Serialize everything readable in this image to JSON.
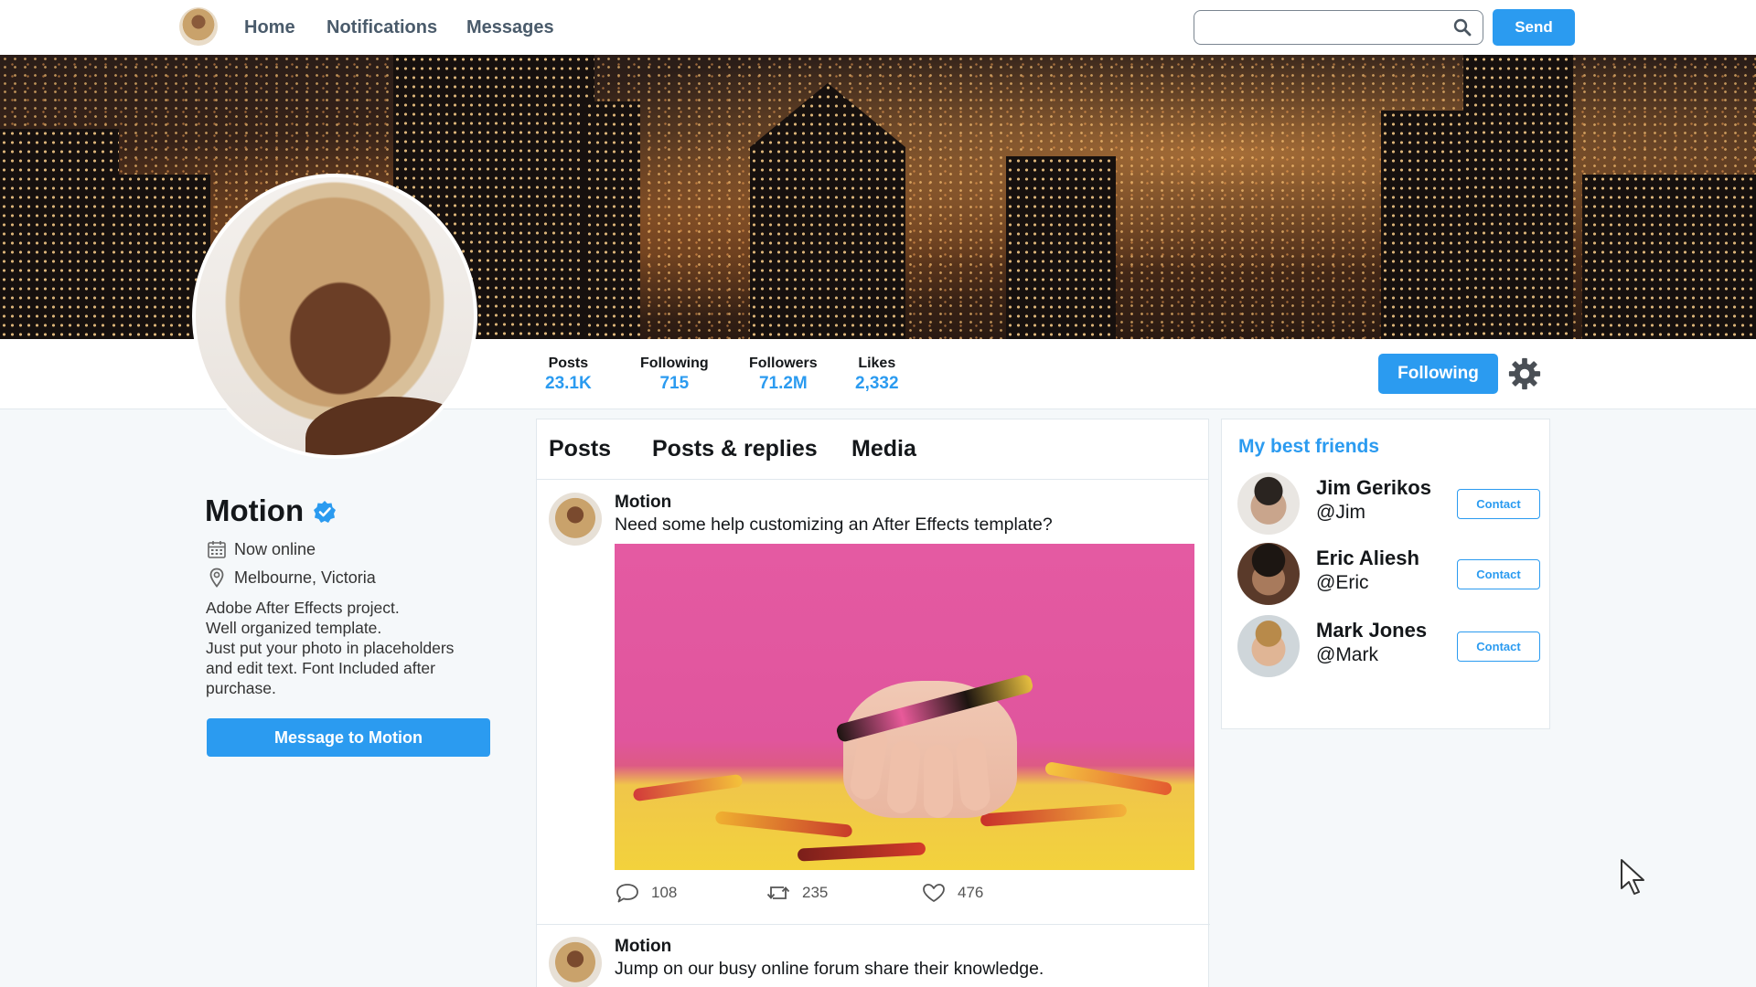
{
  "nav": {
    "links": [
      "Home",
      "Notifications",
      "Messages"
    ],
    "search": {
      "value": "",
      "placeholder": ""
    },
    "send_label": "Send"
  },
  "profile": {
    "name": "Motion",
    "status": "Now online",
    "location": "Melbourne, Victoria",
    "bio": "Adobe After Effects project.\nWell organized template.\nJust put your photo in placeholders\nand edit text. Font Included after\npurchase.",
    "message_button": "Message to Motion",
    "following_button": "Following",
    "stats": [
      {
        "label": "Posts",
        "value": "23.1K"
      },
      {
        "label": "Following",
        "value": "715"
      },
      {
        "label": "Followers",
        "value": "71.2M"
      },
      {
        "label": "Likes",
        "value": "2,332"
      }
    ]
  },
  "feed": {
    "tabs": [
      "Posts",
      "Posts & replies",
      "Media"
    ],
    "posts": [
      {
        "author": "Motion",
        "text": "Need some help customizing an After Effects template?",
        "comments": "108",
        "reposts": "235",
        "likes": "476"
      },
      {
        "author": "Motion",
        "text": "Jump on our busy online forum share their knowledge."
      }
    ]
  },
  "friends": {
    "title": "My best friends",
    "contact_label": "Contact",
    "items": [
      {
        "name": "Jim Gerikos",
        "handle": "@Jim"
      },
      {
        "name": "Eric Aliesh",
        "handle": "@Eric"
      },
      {
        "name": "Mark Jones",
        "handle": "@Mark"
      }
    ]
  },
  "colors": {
    "accent": "#2b9bf0",
    "background": "#f5f8fa",
    "text": "#14171a"
  }
}
